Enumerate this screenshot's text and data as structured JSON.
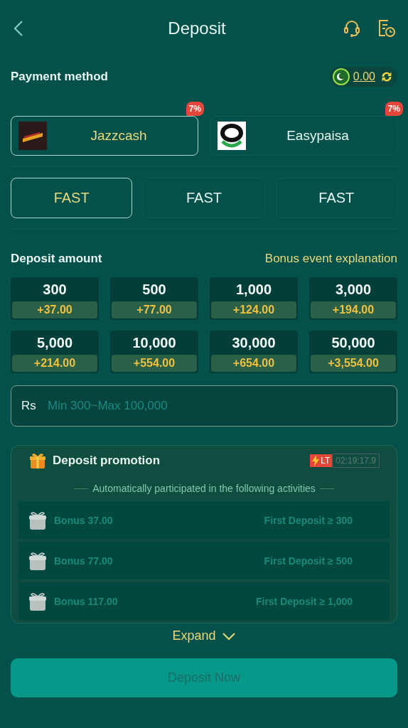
{
  "header": {
    "title": "Deposit"
  },
  "payment": {
    "label": "Payment method",
    "balance": "0.00"
  },
  "methods": [
    {
      "name": "Jazzcash",
      "badge": "7%",
      "selected": true,
      "kind": "jazzcash"
    },
    {
      "name": "Easypaisa",
      "badge": "7%",
      "selected": false,
      "kind": "easypaisa"
    }
  ],
  "channels": [
    {
      "label": "FAST",
      "selected": true
    },
    {
      "label": "FAST",
      "selected": false
    },
    {
      "label": "FAST",
      "selected": false
    }
  ],
  "amount": {
    "label": "Deposit amount",
    "link": "Bonus event explanation"
  },
  "amounts": [
    {
      "value": "300",
      "bonus": "+37.00"
    },
    {
      "value": "500",
      "bonus": "+77.00"
    },
    {
      "value": "1,000",
      "bonus": "+124.00"
    },
    {
      "value": "3,000",
      "bonus": "+194.00"
    },
    {
      "value": "5,000",
      "bonus": "+214.00"
    },
    {
      "value": "10,000",
      "bonus": "+554.00"
    },
    {
      "value": "30,000",
      "bonus": "+654.00"
    },
    {
      "value": "50,000",
      "bonus": "+3,554.00"
    }
  ],
  "input": {
    "prefix": "Rs",
    "placeholder": "Min 300~Max 100,000"
  },
  "promotion": {
    "title": "Deposit promotion",
    "tag": "LT",
    "timer": "02:19:17.9",
    "subtitle": "Automatically participated in the following activities",
    "items": [
      {
        "bonus": "Bonus 37.00",
        "condition": "First Deposit ≥ 300"
      },
      {
        "bonus": "Bonus 77.00",
        "condition": "First Deposit ≥ 500"
      },
      {
        "bonus": "Bonus 117.00",
        "condition": "First Deposit ≥ 1,000"
      }
    ]
  },
  "expand": "Expand",
  "submit": {
    "label": "Deposit Now",
    "disabled": true
  }
}
